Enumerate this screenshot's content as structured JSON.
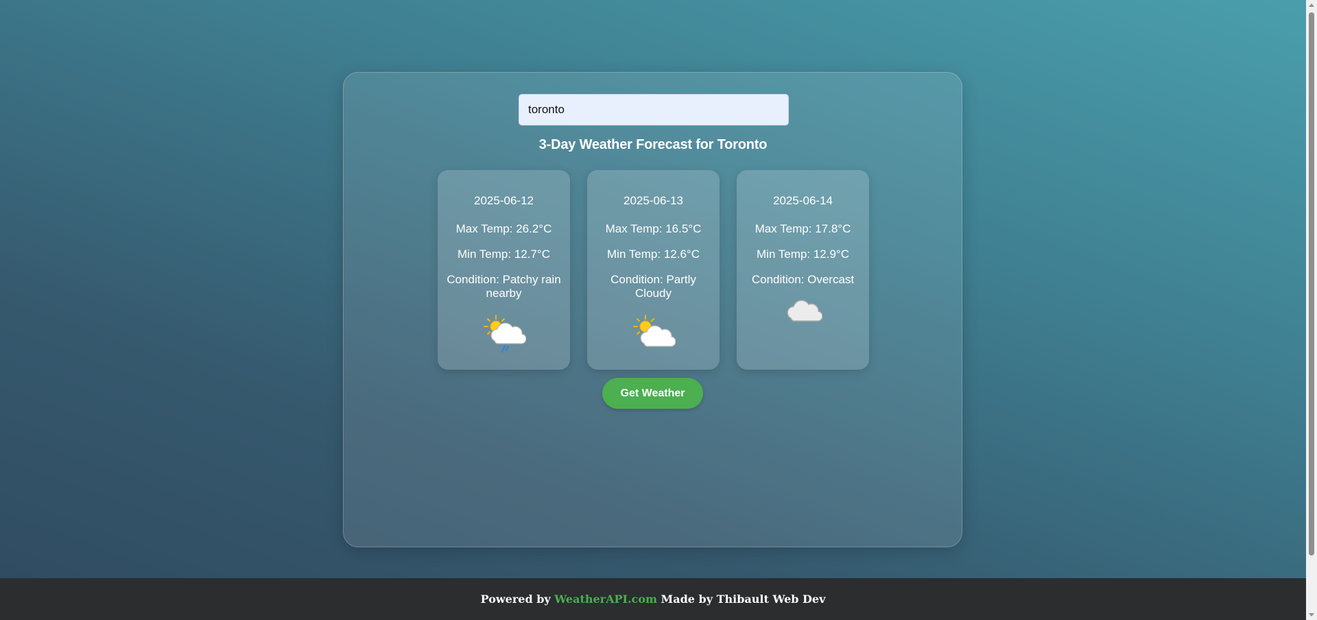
{
  "search": {
    "value": "toronto"
  },
  "forecast": {
    "title": "3-Day Weather Forecast for Toronto",
    "days": [
      {
        "date": "2025-06-12",
        "max_temp": "Max Temp: 26.2°C",
        "min_temp": "Min Temp: 12.7°C",
        "condition": "Condition: Patchy rain nearby",
        "icon": "patchy-rain-icon"
      },
      {
        "date": "2025-06-13",
        "max_temp": "Max Temp: 16.5°C",
        "min_temp": "Min Temp: 12.6°C",
        "condition": "Condition: Partly Cloudy",
        "icon": "partly-cloudy-icon"
      },
      {
        "date": "2025-06-14",
        "max_temp": "Max Temp: 17.8°C",
        "min_temp": "Min Temp: 12.9°C",
        "condition": "Condition: Overcast",
        "icon": "overcast-icon"
      }
    ]
  },
  "button": {
    "label": "Get Weather",
    "color": "#4caf50"
  },
  "footer": {
    "prefix": "Powered by ",
    "link_text": "WeatherAPI.com",
    "suffix": " Made by Thibault Web Dev",
    "link_color": "#4caf50"
  }
}
